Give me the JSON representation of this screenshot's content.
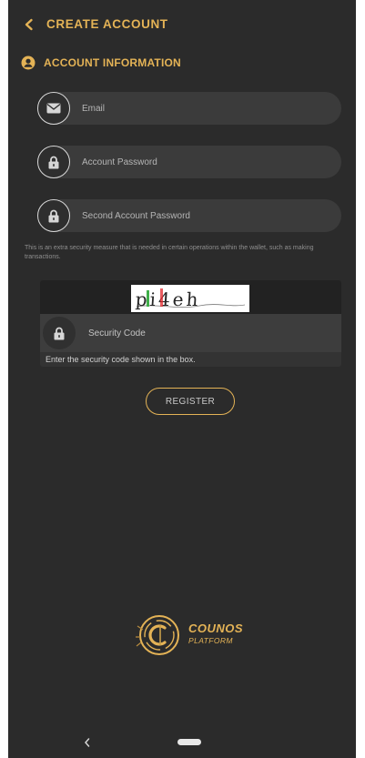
{
  "header": {
    "title": "CREATE ACCOUNT",
    "back_icon": "chevron-left-icon"
  },
  "section": {
    "title": "ACCOUNT INFORMATION",
    "icon": "user-circle-icon"
  },
  "fields": {
    "email": {
      "placeholder": "Email",
      "icon": "envelope-icon"
    },
    "password": {
      "placeholder": "Account Password",
      "icon": "lock-icon"
    },
    "second_password": {
      "placeholder": "Second Account Password",
      "icon": "lock-icon"
    }
  },
  "note": "This is an extra security measure that is needed in certain operations within the wallet, such as making transactions.",
  "captcha": {
    "code_text": "pi4eh",
    "refresh_icon": "refresh-icon",
    "security_placeholder": "Security Code",
    "hint": "Enter the security code shown in the box."
  },
  "register_label": "REGISTER",
  "logo": {
    "line1": "COUNOS",
    "line2": "PLATFORM"
  },
  "colors": {
    "accent": "#e4b356",
    "background": "#2b2b2b",
    "field": "#3b3b3b"
  }
}
